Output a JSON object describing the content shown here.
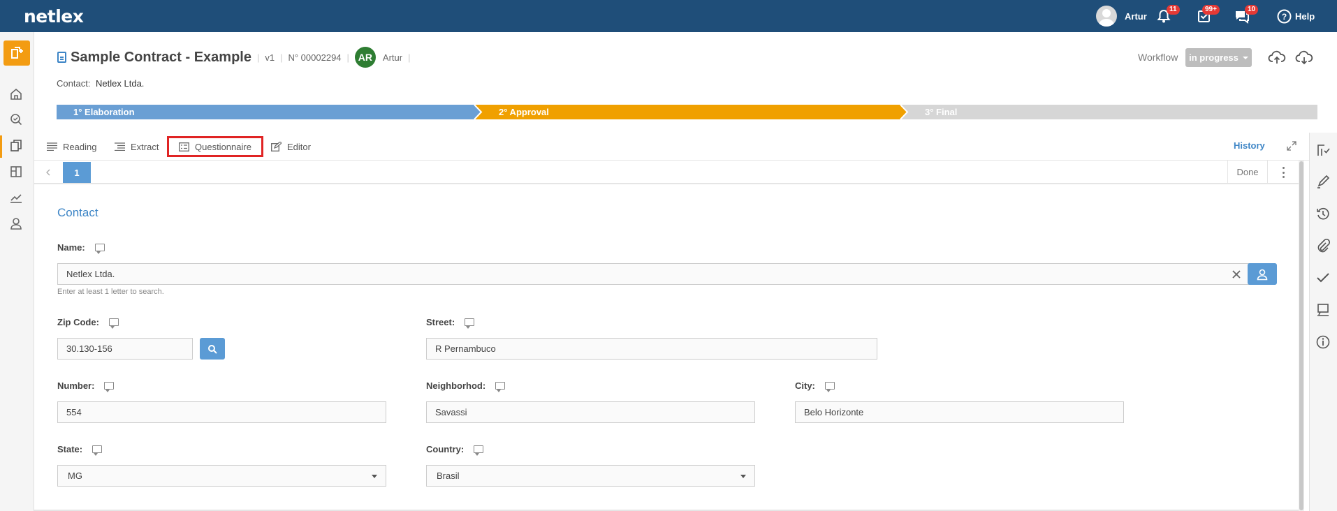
{
  "topbar": {
    "logo": "netlex",
    "user_name": "Artur",
    "notifications_badge": "11",
    "tasks_badge": "99+",
    "messages_badge": "10",
    "help_label": "Help"
  },
  "document": {
    "title": "Sample Contract - Example",
    "version": "v1",
    "number": "N° 00002294",
    "owner_initials": "AR",
    "owner_name": "Artur",
    "contact_label": "Contact:",
    "contact_value": "Netlex Ltda."
  },
  "workflow": {
    "label": "Workflow",
    "status": "in progress"
  },
  "steps": [
    {
      "label": "1° Elaboration",
      "color": "#6a9fd4"
    },
    {
      "label": "2° Approval",
      "color": "#f0a000"
    },
    {
      "label": "3° Final",
      "color": "#d6d6d6"
    }
  ],
  "tabs": {
    "reading": "Reading",
    "extract": "Extract",
    "questionnaire": "Questionnaire",
    "editor": "Editor",
    "history": "History"
  },
  "pager": {
    "current_page": "1",
    "done_label": "Done"
  },
  "form": {
    "section_title": "Contact",
    "name_label": "Name:",
    "name_value": "Netlex Ltda.",
    "name_hint": "Enter at least 1 letter to search.",
    "zip_label": "Zip Code:",
    "zip_value": "30.130-156",
    "street_label": "Street:",
    "street_value": "R Pernambuco",
    "number_label": "Number:",
    "number_value": "554",
    "neighborhood_label": "Neighborhod:",
    "neighborhood_value": "Savassi",
    "city_label": "City:",
    "city_value": "Belo Horizonte",
    "state_label": "State:",
    "state_value": "MG",
    "country_label": "Country:",
    "country_value": "Brasil"
  },
  "colors": {
    "topbar": "#1f4e79",
    "accent_blue": "#3d85c6",
    "accent_orange": "#f39c12",
    "highlight_red": "#e02424"
  },
  "icons": {
    "left_sidebar": [
      "new-document-icon",
      "home-icon",
      "search-documents-icon",
      "documents-icon",
      "board-icon",
      "chart-icon",
      "user-icon"
    ],
    "right_sidebar": [
      "flow-icon",
      "pen-icon",
      "history-icon",
      "paperclip-icon",
      "check-icon",
      "comment-board-icon",
      "info-icon"
    ]
  }
}
